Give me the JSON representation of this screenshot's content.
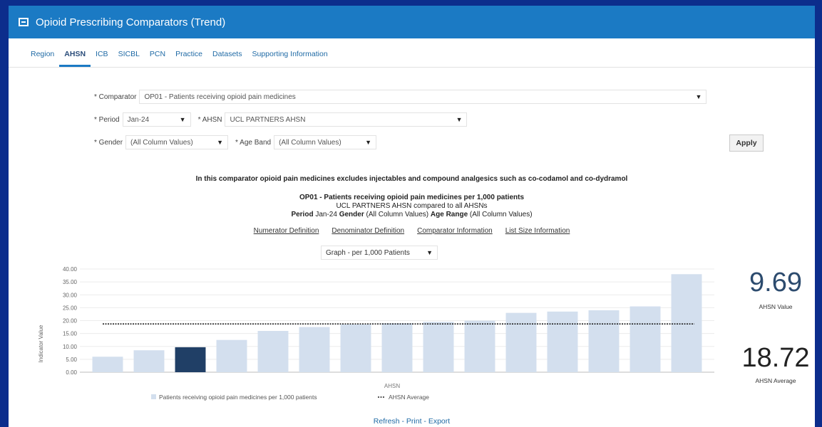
{
  "window": {
    "title": "Opioid Prescribing Comparators (Trend)"
  },
  "tabs": [
    {
      "label": "Region",
      "active": false
    },
    {
      "label": "AHSN",
      "active": true
    },
    {
      "label": "ICB",
      "active": false
    },
    {
      "label": "SICBL",
      "active": false
    },
    {
      "label": "PCN",
      "active": false
    },
    {
      "label": "Practice",
      "active": false
    },
    {
      "label": "Datasets",
      "active": false
    },
    {
      "label": "Supporting Information",
      "active": false
    }
  ],
  "filters": {
    "comparator": {
      "label": "* Comparator",
      "value": "OP01 - Patients receiving opioid pain medicines"
    },
    "period": {
      "label": "* Period",
      "value": "Jan-24"
    },
    "ahsn": {
      "label": "* AHSN",
      "value": "UCL PARTNERS AHSN"
    },
    "gender": {
      "label": "* Gender",
      "value": "(All Column Values)"
    },
    "age_band": {
      "label": "* Age Band",
      "value": "(All Column Values)"
    },
    "apply_label": "Apply"
  },
  "notes": {
    "exclusion": "In this comparator opioid pain medicines excludes injectables and compound analgesics such as co-codamol and co-dydramol",
    "chart_title": "OP01 - Patients receiving opioid pain medicines per 1,000 patients",
    "comparison": "UCL PARTNERS AHSN compared to all AHSNs",
    "period_label": "Period",
    "period_value": "Jan-24",
    "gender_label": "Gender",
    "gender_value": "(All Column Values)",
    "age_label": "Age Range",
    "age_value": "(All Column Values)"
  },
  "links": [
    "Numerator Definition",
    "Denominator Definition",
    "Comparator Information",
    "List Size Information"
  ],
  "graph_selector": "Graph - per 1,000 Patients",
  "kpis": {
    "value": "9.69",
    "value_label": "AHSN Value",
    "average": "18.72",
    "average_label": "AHSN Average"
  },
  "footer": {
    "refresh": "Refresh",
    "print": "Print",
    "export": "Export",
    "sep": " - "
  },
  "colors": {
    "bar": "#d3dfee",
    "highlight": "#203f66",
    "average_line": "#222222",
    "title_bar": "#1b7ac4"
  },
  "chart_data": {
    "type": "bar",
    "ylabel": "Indicator Value",
    "xlabel": "AHSN",
    "ylim": [
      0,
      40
    ],
    "yticks": [
      "0.00",
      "5.00",
      "10.00",
      "15.00",
      "20.00",
      "25.00",
      "30.00",
      "35.00",
      "40.00"
    ],
    "values": [
      6.0,
      8.5,
      9.69,
      12.5,
      16.0,
      17.5,
      18.5,
      19.0,
      19.5,
      20.0,
      23.0,
      23.5,
      24.0,
      25.5,
      38.0
    ],
    "highlight_index": 2,
    "average": 18.72,
    "legend": [
      "Patients receiving opioid pain medicines per 1,000 patients",
      "AHSN Average"
    ],
    "grid": true
  }
}
